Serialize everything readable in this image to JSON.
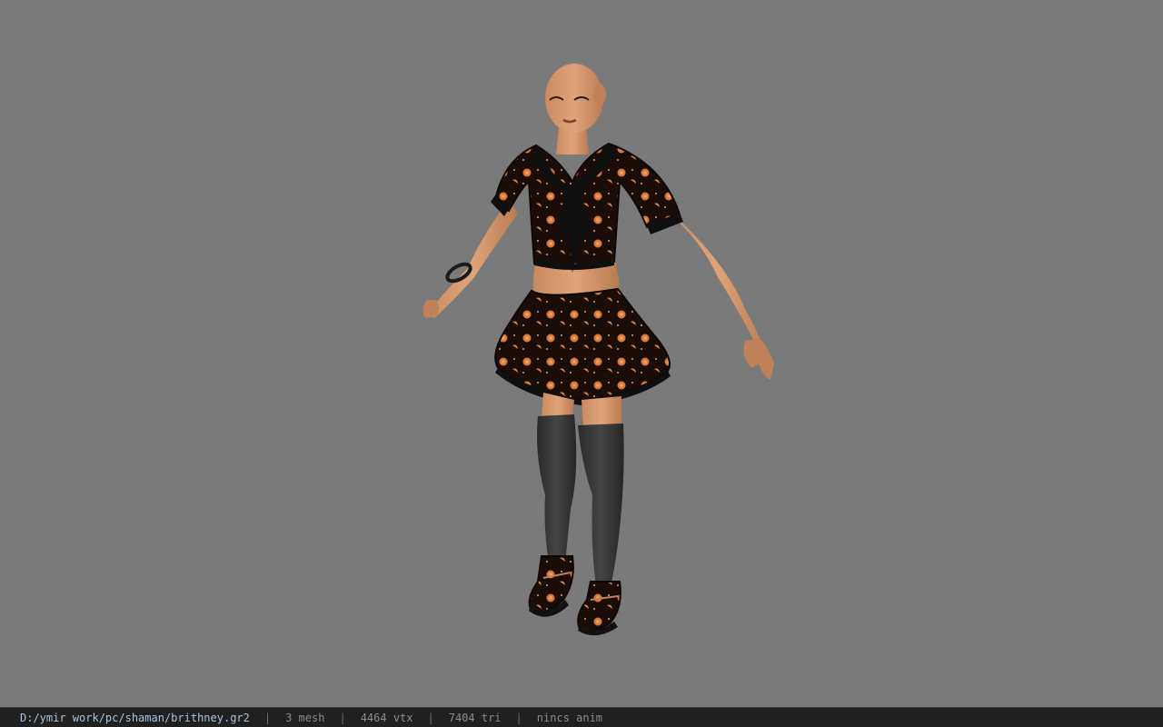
{
  "viewer": {
    "background_color": "#7a7a7a",
    "model_icon": "character-model-icon"
  },
  "statusbar": {
    "file_path": "D:/ymir work/pc/shaman/brithney.gr2",
    "separator": "|",
    "mesh_count": "3 mesh",
    "vertex_count": "4464 vtx",
    "triangle_count": "7404 tri",
    "anim_status": "nincs anim"
  }
}
